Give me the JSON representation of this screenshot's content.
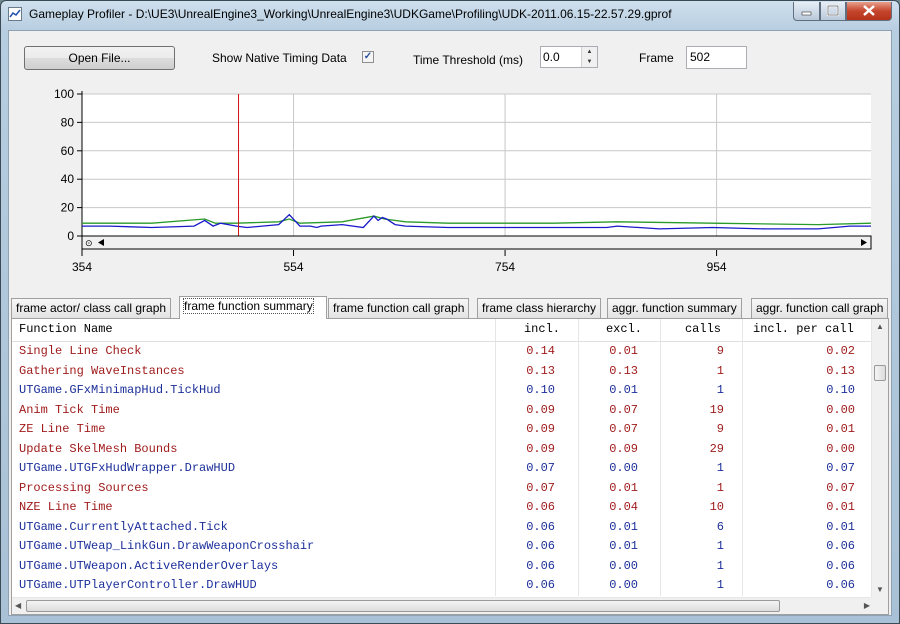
{
  "window": {
    "title": "Gameplay Profiler - D:\\UE3\\UnrealEngine3_Working\\UnrealEngine3\\UDKGame\\Profiling\\UDK-2011.06.15-22.57.29.gprof"
  },
  "toolbar": {
    "open_file_label": "Open File...",
    "show_native_label": "Show Native Timing Data",
    "show_native_checked": true,
    "threshold_label": "Time Threshold (ms)",
    "threshold_value": "0.0",
    "frame_label": "Frame",
    "frame_value": "502"
  },
  "chart_data": {
    "type": "line",
    "y_ticks": [
      "100",
      "80",
      "60",
      "40",
      "20",
      "0"
    ],
    "x_ticks": [
      "354",
      "554",
      "754",
      "954"
    ],
    "ylim": [
      0,
      100
    ],
    "xlim": [
      354,
      1100
    ],
    "grid": true,
    "selected_frame": 502,
    "colors": {
      "series_a": "#1a1acc",
      "series_b": "#2a9a2a",
      "marker": "#d01010"
    },
    "series": [
      {
        "x": [
          354,
          380,
          420,
          460,
          470,
          478,
          485,
          500,
          510,
          540,
          550,
          560,
          570,
          576,
          580,
          600,
          620,
          630,
          634,
          638,
          642,
          646,
          650,
          660,
          700,
          760,
          800,
          850,
          860,
          900,
          950,
          1000,
          1050,
          1080,
          1100
        ],
        "values": [
          7,
          7,
          6,
          7,
          11,
          7,
          9,
          7,
          6,
          8,
          15,
          7,
          7,
          6,
          7,
          8,
          6,
          14,
          11,
          13,
          12,
          10,
          8,
          7,
          6,
          6,
          6,
          6,
          7,
          5,
          6,
          5,
          5,
          7,
          7
        ]
      },
      {
        "x": [
          354,
          420,
          470,
          480,
          500,
          540,
          550,
          560,
          600,
          630,
          640,
          660,
          700,
          800,
          860,
          950,
          1050,
          1100
        ],
        "values": [
          9,
          9,
          12,
          9,
          9,
          10,
          12,
          9,
          10,
          14,
          12,
          10,
          9,
          9,
          10,
          9,
          8,
          9
        ]
      }
    ]
  },
  "tabs": [
    {
      "label": "frame actor/ class call graph",
      "active": false
    },
    {
      "label": "frame function summary",
      "active": true
    },
    {
      "label": "frame function call graph",
      "active": false
    },
    {
      "label": "frame class hierarchy",
      "active": false
    },
    {
      "label": "aggr. function summary",
      "active": false
    },
    {
      "label": "aggr. function call graph",
      "active": false
    }
  ],
  "table": {
    "columns": [
      "Function Name",
      "incl.",
      "excl.",
      "calls",
      "incl. per call"
    ],
    "rows": [
      {
        "name": "Single Line Check",
        "incl": "0.14",
        "excl": "0.01",
        "calls": "9",
        "per_call": "0.02",
        "color": "red"
      },
      {
        "name": "Gathering WaveInstances",
        "incl": "0.13",
        "excl": "0.13",
        "calls": "1",
        "per_call": "0.13",
        "color": "red"
      },
      {
        "name": "UTGame.GFxMinimapHud.TickHud",
        "incl": "0.10",
        "excl": "0.01",
        "calls": "1",
        "per_call": "0.10",
        "color": "blue"
      },
      {
        "name": "Anim Tick Time",
        "incl": "0.09",
        "excl": "0.07",
        "calls": "19",
        "per_call": "0.00",
        "color": "red"
      },
      {
        "name": "ZE Line Time",
        "incl": "0.09",
        "excl": "0.07",
        "calls": "9",
        "per_call": "0.01",
        "color": "red"
      },
      {
        "name": "Update SkelMesh Bounds",
        "incl": "0.09",
        "excl": "0.09",
        "calls": "29",
        "per_call": "0.00",
        "color": "red"
      },
      {
        "name": "UTGame.UTGFxHudWrapper.DrawHUD",
        "incl": "0.07",
        "excl": "0.00",
        "calls": "1",
        "per_call": "0.07",
        "color": "blue"
      },
      {
        "name": "Processing Sources",
        "incl": "0.07",
        "excl": "0.01",
        "calls": "1",
        "per_call": "0.07",
        "color": "red"
      },
      {
        "name": "NZE Line Time",
        "incl": "0.06",
        "excl": "0.04",
        "calls": "10",
        "per_call": "0.01",
        "color": "red"
      },
      {
        "name": "UTGame.CurrentlyAttached.Tick",
        "incl": "0.06",
        "excl": "0.01",
        "calls": "6",
        "per_call": "0.01",
        "color": "blue"
      },
      {
        "name": "UTGame.UTWeap_LinkGun.DrawWeaponCrosshair",
        "incl": "0.06",
        "excl": "0.01",
        "calls": "1",
        "per_call": "0.06",
        "color": "blue"
      },
      {
        "name": "UTGame.UTWeapon.ActiveRenderOverlays",
        "incl": "0.06",
        "excl": "0.00",
        "calls": "1",
        "per_call": "0.06",
        "color": "blue"
      },
      {
        "name": "UTGame.UTPlayerController.DrawHUD",
        "incl": "0.06",
        "excl": "0.00",
        "calls": "1",
        "per_call": "0.06",
        "color": "blue"
      }
    ]
  }
}
